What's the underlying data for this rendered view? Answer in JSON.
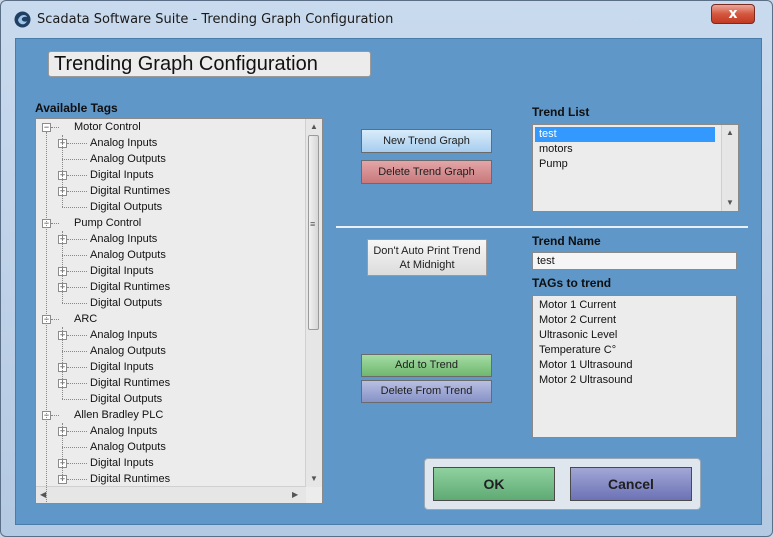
{
  "window": {
    "title": "Scadata Software Suite - Trending Graph Configuration",
    "close_label": "x"
  },
  "header": {
    "title": "Trending Graph Configuration"
  },
  "available_tags": {
    "label": "Available Tags",
    "groups": [
      {
        "name": "Motor Control",
        "children": [
          "Analog Inputs",
          "Analog Outputs",
          "Digital Inputs",
          "Digital Runtimes",
          "Digital Outputs"
        ]
      },
      {
        "name": "Pump Control",
        "children": [
          "Analog Inputs",
          "Analog Outputs",
          "Digital Inputs",
          "Digital Runtimes",
          "Digital Outputs"
        ]
      },
      {
        "name": "ARC",
        "children": [
          "Analog Inputs",
          "Analog Outputs",
          "Digital Inputs",
          "Digital Runtimes",
          "Digital Outputs"
        ]
      },
      {
        "name": "Allen Bradley PLC",
        "children": [
          "Analog Inputs",
          "Analog Outputs",
          "Digital Inputs",
          "Digital Runtimes"
        ]
      }
    ]
  },
  "buttons": {
    "new_trend": "New Trend Graph",
    "delete_trend": "Delete Trend Graph",
    "no_print_line1": "Don't Auto Print Trend",
    "no_print_line2": "At Midnight",
    "add_to_trend": "Add to Trend",
    "delete_from_trend": "Delete From Trend",
    "ok": "OK",
    "cancel": "Cancel"
  },
  "trend_list": {
    "label": "Trend List",
    "items": [
      "test",
      "motors",
      "Pump"
    ],
    "selected": "test"
  },
  "trend_name": {
    "label": "Trend Name",
    "value": "test"
  },
  "tags_to_trend": {
    "label": "TAGs to trend",
    "items": [
      "Motor 1 Current",
      "Motor 2 Current",
      "Ultrasonic Level",
      "Temperature C°",
      "Motor 1 Ultrasound",
      "Motor 2 Ultrasound"
    ]
  }
}
